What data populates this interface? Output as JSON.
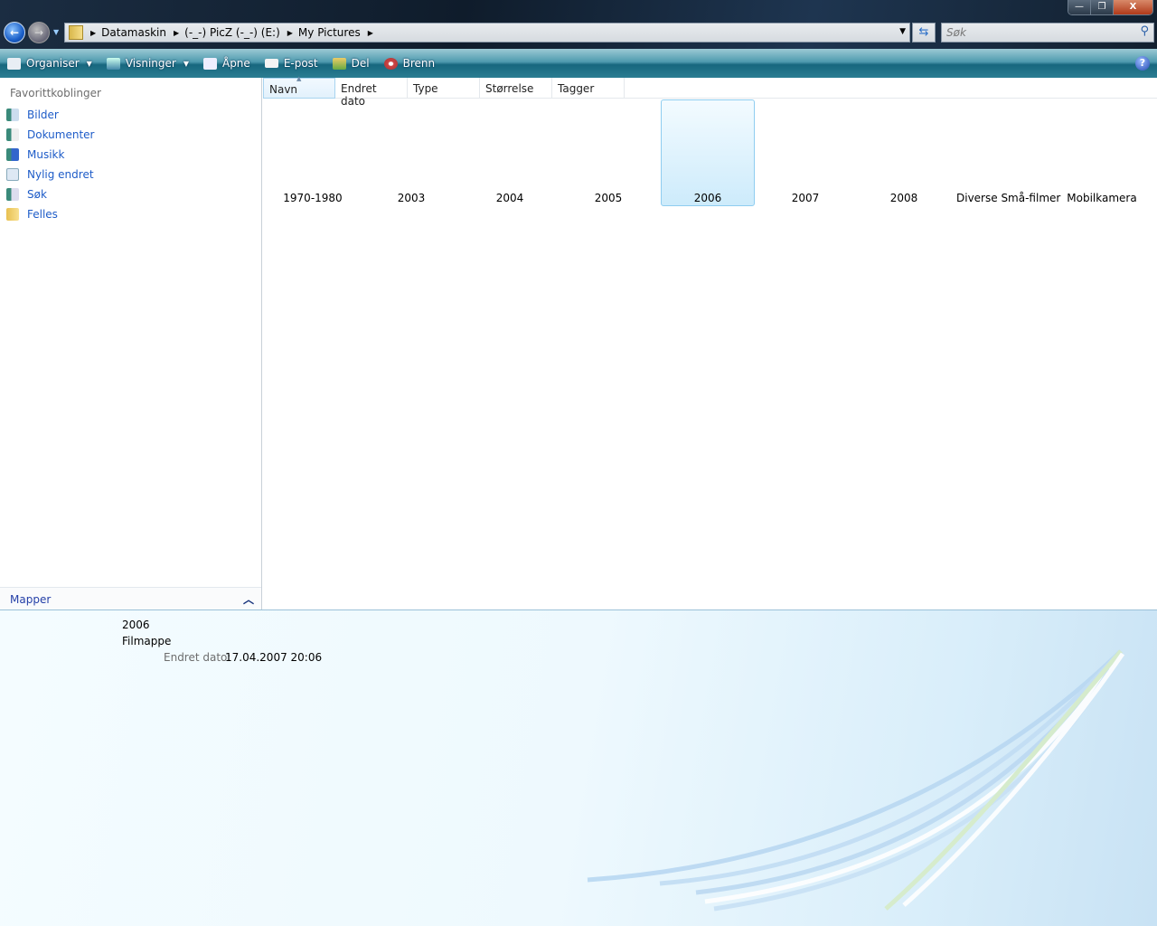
{
  "window": {
    "minimize": "—",
    "restore": "❐",
    "close": "X"
  },
  "address": {
    "segments": [
      "Datamaskin",
      "(-_-) PicZ (-_-) (E:)",
      "My Pictures"
    ]
  },
  "search": {
    "placeholder": "Søk"
  },
  "toolbar": {
    "organise": "Organiser",
    "views": "Visninger",
    "open": "Åpne",
    "email": "E-post",
    "share": "Del",
    "burn": "Brenn",
    "help": "?"
  },
  "sidebar": {
    "title": "Favorittkoblinger",
    "items": [
      {
        "label": "Bilder"
      },
      {
        "label": "Dokumenter"
      },
      {
        "label": "Musikk"
      },
      {
        "label": "Nylig endret"
      },
      {
        "label": "Søk"
      },
      {
        "label": "Felles"
      }
    ],
    "folders": "Mapper"
  },
  "columns": [
    "Navn",
    "Endret dato",
    "Type",
    "Størrelse",
    "Tagger"
  ],
  "items": [
    "1970-1980",
    "2003",
    "2004",
    "2005",
    "2006",
    "2007",
    "2008",
    "Diverse Små-filmer",
    "Mobilkamera"
  ],
  "selected_index": 4,
  "details": {
    "name": "2006",
    "type": "Filmappe",
    "modified_label": "Endret dato:",
    "modified_value": "17.04.2007 20:06"
  }
}
